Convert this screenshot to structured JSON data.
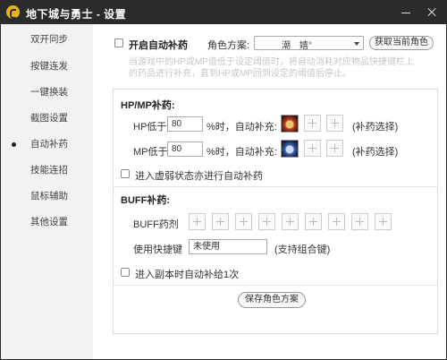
{
  "window": {
    "title": "地下城与勇士 - 设置"
  },
  "sidebar": {
    "items": [
      {
        "label": "双开同步"
      },
      {
        "label": "按键连发"
      },
      {
        "label": "一键换装"
      },
      {
        "label": "截图设置"
      },
      {
        "label": "自动补药"
      },
      {
        "label": "技能连招"
      },
      {
        "label": "鼠标辅助"
      },
      {
        "label": "其他设置"
      }
    ],
    "active": "自动补药"
  },
  "header": {
    "enable_label": "开启自动补药",
    "role_scheme_label": "角色方案:",
    "role_scheme_value": "潮　嬉°",
    "get_role_button": "获取当前角色",
    "hint_line1": "当游戏中的HP或MP值低于设定阈值时，将自动消耗对应物品快捷键栏上",
    "hint_line2": "的药品进行补充，直到HP或MP回到设定的阈值后停止。"
  },
  "hpmp": {
    "section_title": "HP/MP补药:",
    "hp_label": "HP低于",
    "hp_value": "80",
    "hp_suffix": "%时，自动补充:",
    "mp_label": "MP低于",
    "mp_value": "80",
    "mp_suffix": "%时，自动补充:",
    "select_hint": "(补药选择)",
    "weak_label": "进入虚弱状态亦进行自动补药"
  },
  "buff": {
    "section_title": "BUFF补药:",
    "potion_label": "BUFF药剂",
    "slot_count": 9,
    "hotkey_label": "使用快捷键",
    "hotkey_value": "未使用",
    "hotkey_hint": "(支持组合键)",
    "dungeon_label": "进入副本时自动补给1次"
  },
  "footer": {
    "save_button": "保存角色方案"
  },
  "icons": {
    "hp_potion": "hp-potion-icon",
    "mp_potion": "mp-potion-icon",
    "add": "plus-icon"
  }
}
